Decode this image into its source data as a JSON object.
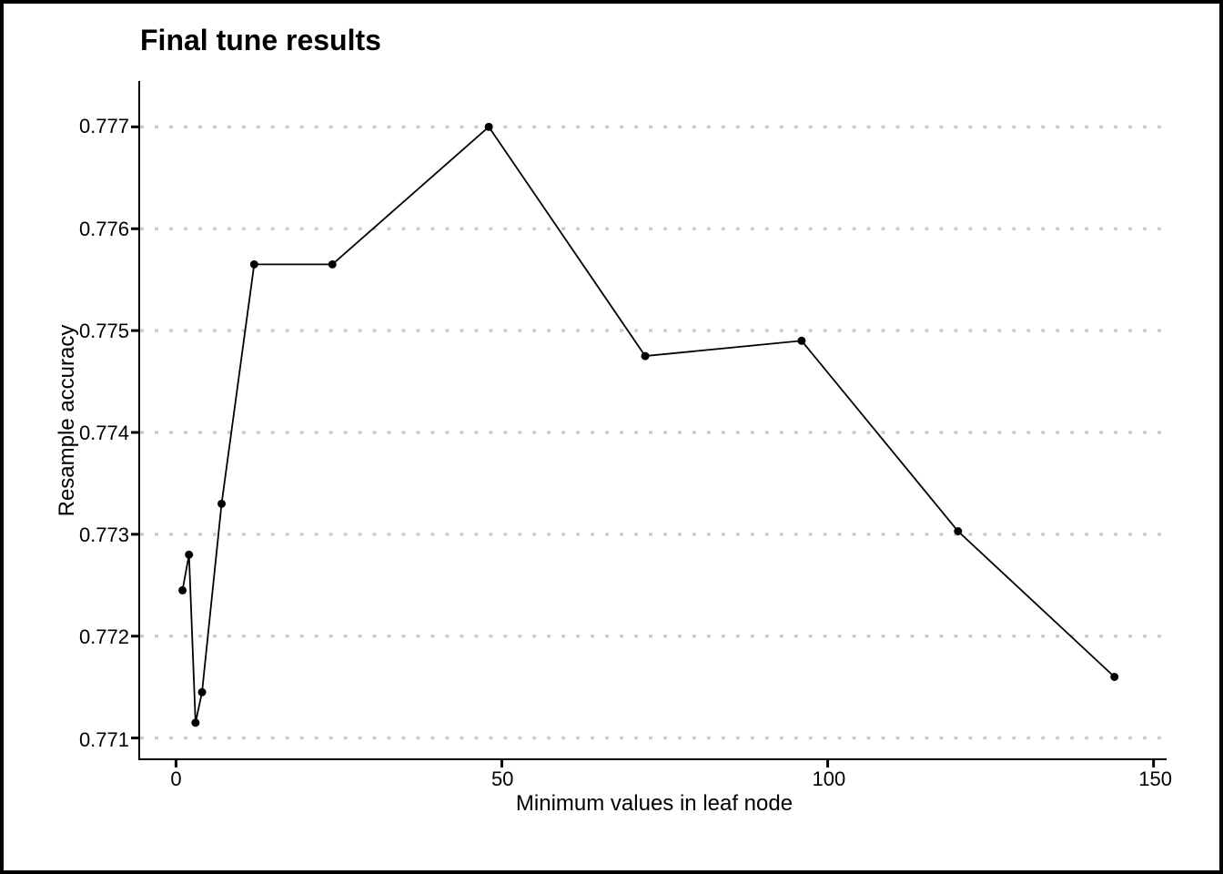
{
  "chart_data": {
    "type": "line",
    "title": "Final tune results",
    "xlabel": "Minimum values in leaf node",
    "ylabel": "Resample accuracy",
    "x": [
      1,
      2,
      3,
      4,
      7,
      12,
      24,
      48,
      72,
      96,
      120,
      144
    ],
    "y": [
      0.77245,
      0.7728,
      0.77115,
      0.77145,
      0.7733,
      0.77565,
      0.77565,
      0.777,
      0.77475,
      0.7749,
      0.77303,
      0.7716
    ],
    "x_ticks": [
      0,
      50,
      100,
      150
    ],
    "y_ticks": [
      0.771,
      0.772,
      0.773,
      0.774,
      0.775,
      0.776,
      0.777
    ],
    "y_tick_labels": [
      "0.771",
      "0.772",
      "0.773",
      "0.774",
      "0.775",
      "0.776",
      "0.777"
    ],
    "xlim": [
      -5.5,
      152
    ],
    "ylim": [
      0.7708,
      0.77745
    ]
  }
}
